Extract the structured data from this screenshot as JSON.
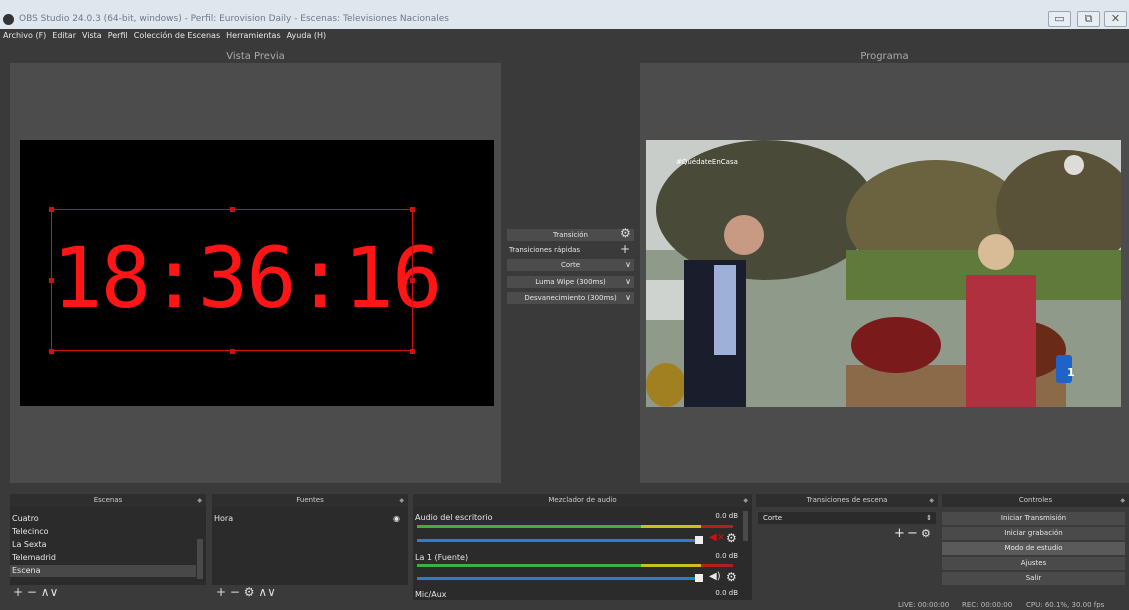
{
  "window": {
    "title": "OBS Studio 24.0.3 (64-bit, windows) - Perfil: Eurovision Daily - Escenas: Televisiones Nacionales",
    "controls": {
      "minimize": "▭",
      "restore": "⧉",
      "close": "✕"
    }
  },
  "menu": [
    "Archivo (F)",
    "Editar",
    "Vista",
    "Perfil",
    "Colección de Escenas",
    "Herramientas",
    "Ayuda (H)"
  ],
  "preview": {
    "title": "Vista Previa",
    "clock_text": "18:36:16",
    "clock_color": "#ff1515"
  },
  "program": {
    "title": "Programa",
    "hashtag": "#QuédateEnCasa",
    "channel_logo": "1"
  },
  "transitions_panel": {
    "transition_label": "Transición",
    "quick_label": "Transiciones rápidas",
    "items": [
      "Corte",
      "Luma Wipe (300ms)",
      "Desvanecimiento (300ms)"
    ]
  },
  "docks": {
    "scenes": {
      "title": "Escenas",
      "items": [
        "Cuatro",
        "Telecinco",
        "La Sexta",
        "Telemadrid",
        "Escena"
      ],
      "selected": "Escena"
    },
    "sources": {
      "title": "Fuentes",
      "items": [
        "Hora"
      ]
    },
    "mixer": {
      "title": "Mezclador de audio",
      "channels": [
        {
          "name": "Audio del escritorio",
          "db": "0.0 dB",
          "muted": true
        },
        {
          "name": "La 1 (Fuente)",
          "db": "0.0 dB",
          "muted": false
        },
        {
          "name": "Mic/Aux",
          "db": "0.0 dB",
          "muted": false
        }
      ]
    },
    "scene_transitions": {
      "title": "Transiciones de escena",
      "selected": "Corte"
    },
    "controls": {
      "title": "Controles",
      "buttons": [
        "Iniciar Transmisión",
        "Iniciar grabación",
        "Modo de estudio",
        "Ajustes",
        "Salir"
      ]
    }
  },
  "status": {
    "live": "LIVE: 00:00:00",
    "rec": "REC: 00:00:00",
    "cpu": "CPU: 60.1%, 30.00 fps"
  },
  "colors": {
    "panel_bg": "#3a3a3a",
    "dock_bg": "#2b2b2b",
    "accent_red": "#d01010",
    "meter_green": "#3cb043",
    "meter_yellow": "#c8c020",
    "meter_blue": "#2f7bd0"
  }
}
